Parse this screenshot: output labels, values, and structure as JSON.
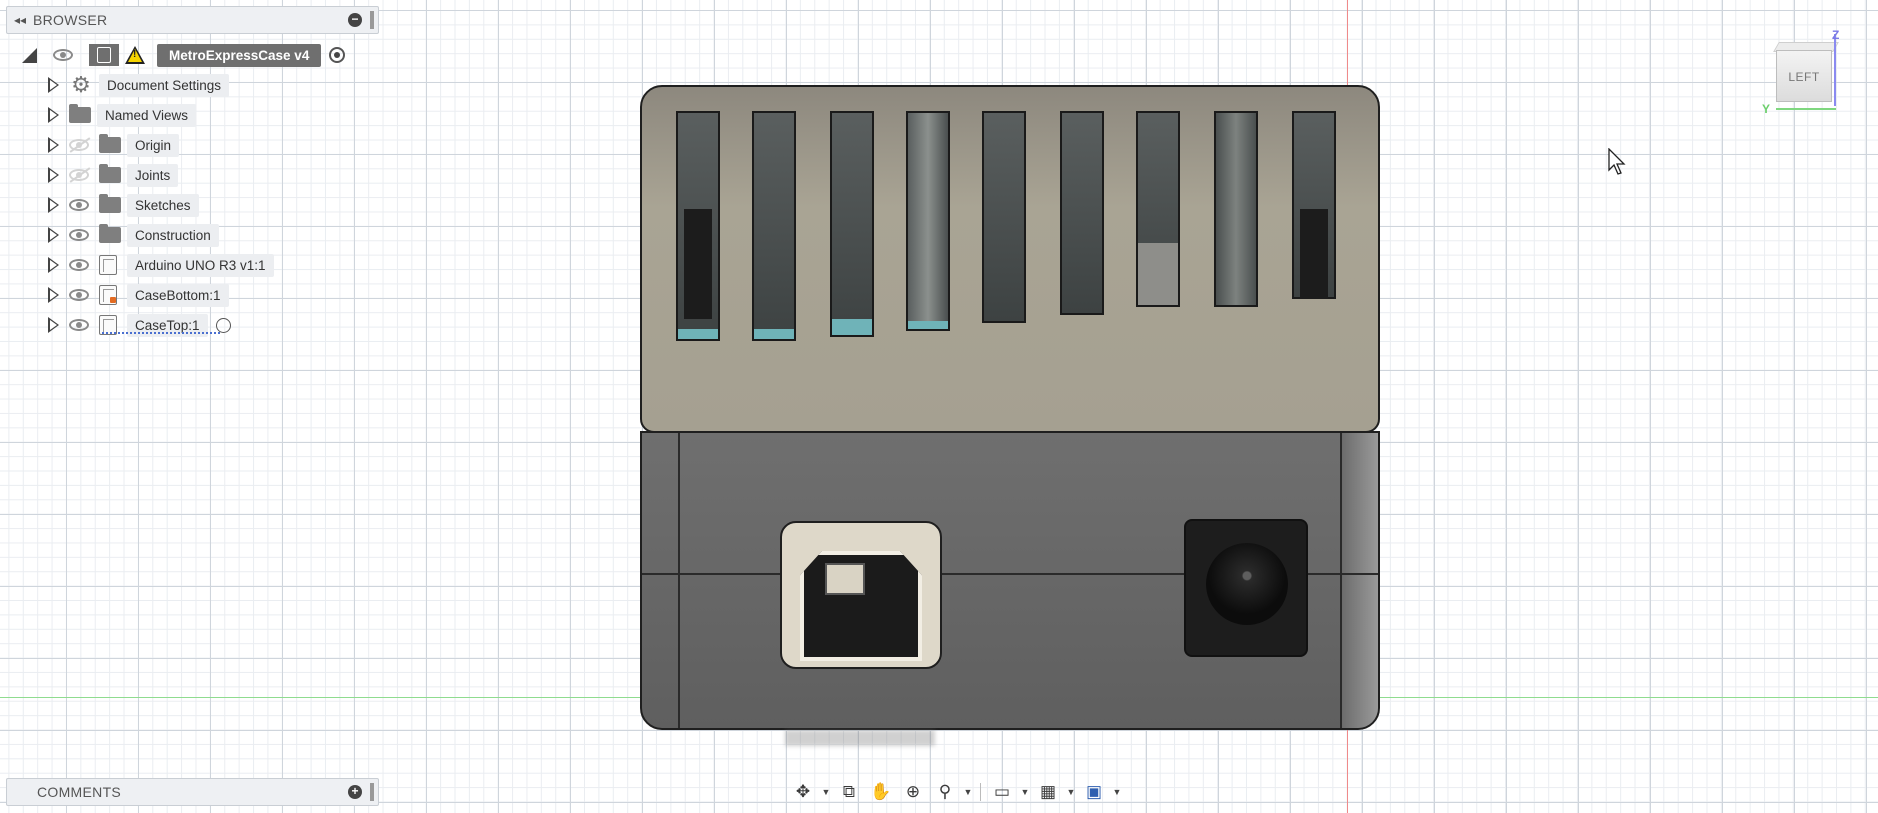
{
  "browser": {
    "title": "BROWSER",
    "root": {
      "label": "MetroExpressCase v4"
    },
    "items": [
      {
        "label": "Document Settings",
        "icon": "gear-icon"
      },
      {
        "label": "Named Views",
        "icon": "folder-icon"
      },
      {
        "label": "Origin",
        "icon": "folder-icon",
        "visible": false
      },
      {
        "label": "Joints",
        "icon": "folder-icon",
        "visible": false
      },
      {
        "label": "Sketches",
        "icon": "folder-icon",
        "visible": true
      },
      {
        "label": "Construction",
        "icon": "folder-icon",
        "visible": true
      },
      {
        "label": "Arduino UNO R3 v1:1",
        "icon": "component-icon",
        "visible": true
      },
      {
        "label": "CaseBottom:1",
        "icon": "component-warning-icon",
        "visible": true
      },
      {
        "label": "CaseTop:1",
        "icon": "component-icon",
        "visible": true
      }
    ]
  },
  "comments": {
    "title": "COMMENTS"
  },
  "viewcube": {
    "face": "LEFT",
    "z": "Z",
    "y": "Y"
  },
  "colors": {
    "lid": "#a5a091",
    "body": "#666666",
    "axis_red": "#f08a8a",
    "axis_green": "#8fdc8f"
  },
  "toolbar": {
    "buttons": [
      "orbit-icon",
      "look-at-icon",
      "pan-icon",
      "zoom-icon",
      "fit-icon",
      "display-settings-icon",
      "grid-icon",
      "viewports-icon"
    ]
  }
}
